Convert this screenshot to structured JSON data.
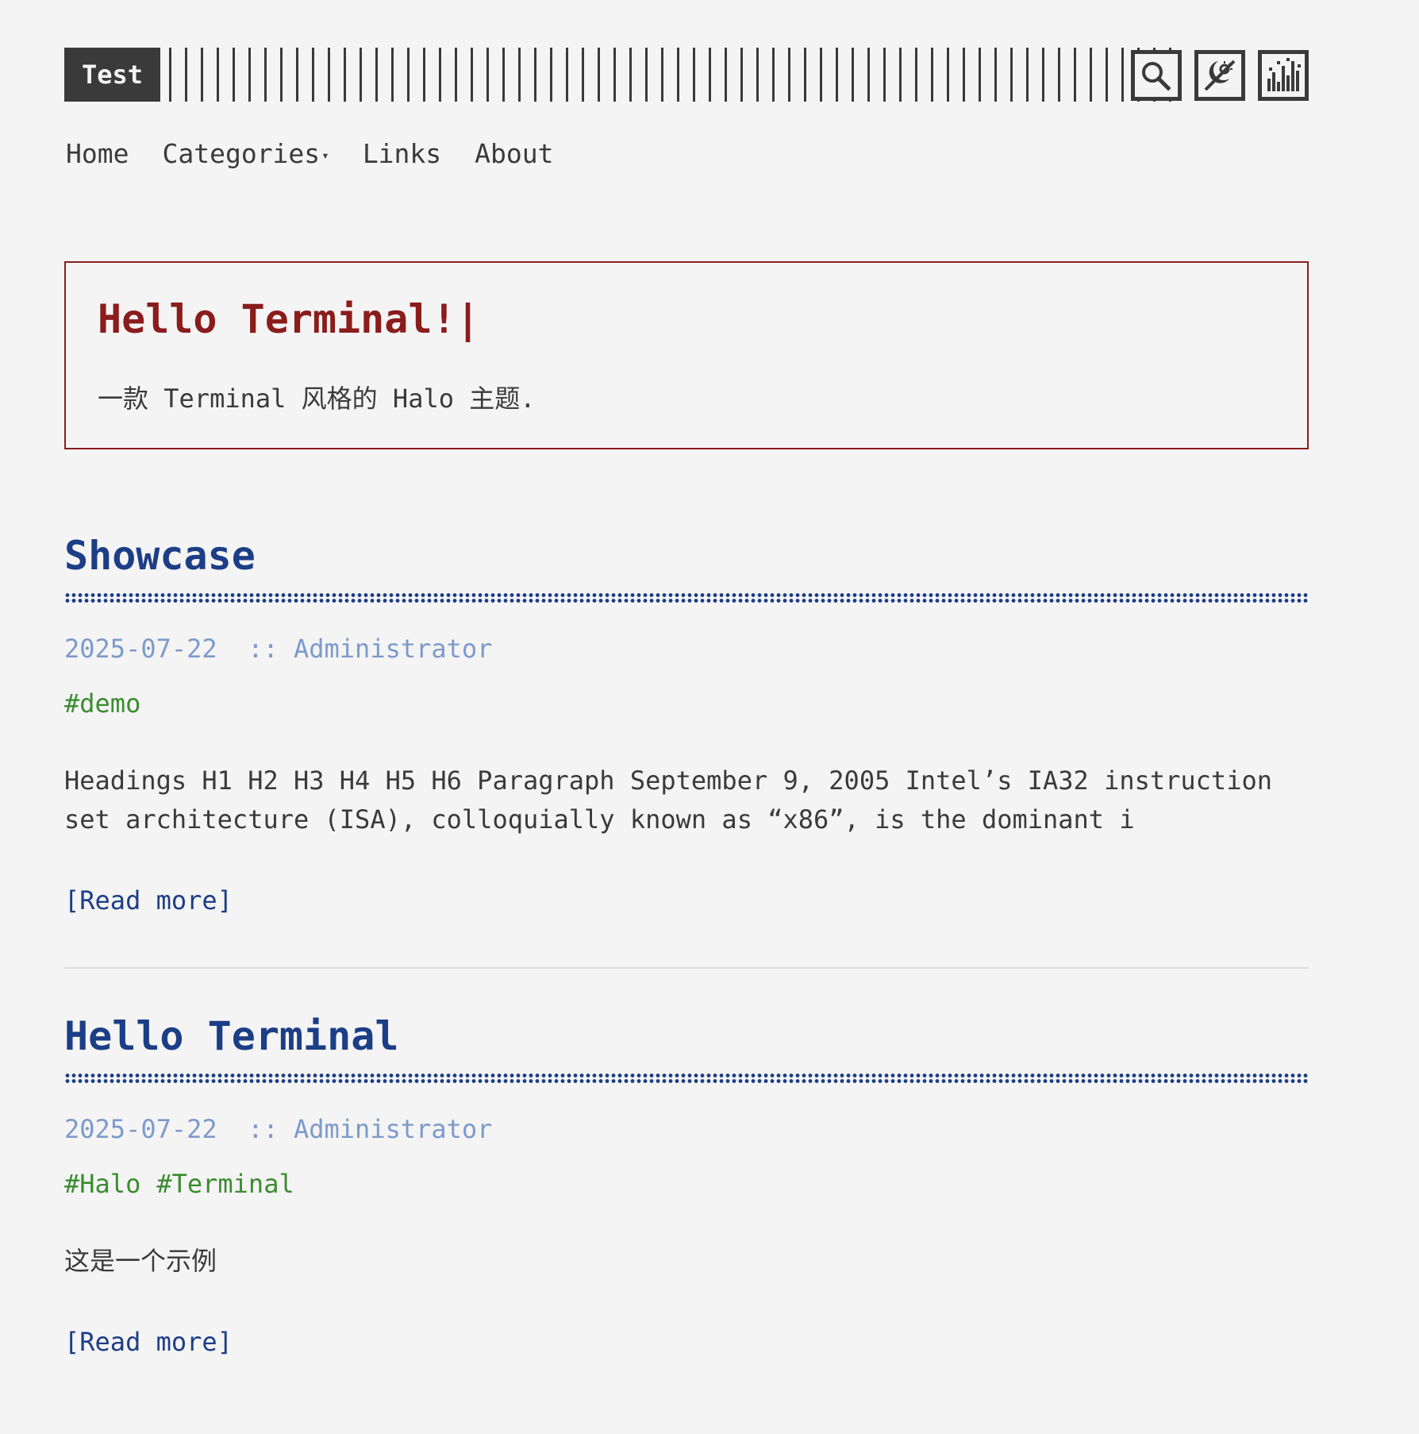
{
  "header": {
    "logo_text": "Test",
    "search_icon": "search-icon",
    "theme_icon": "theme-toggle-icon",
    "style_icon": "style-switch-icon"
  },
  "nav": {
    "items": [
      "Home",
      "Categories",
      "Links",
      "About"
    ],
    "categories_caret": "▾"
  },
  "hero": {
    "title": "Hello Terminal!",
    "cursor": "|",
    "subtitle": "一款 Terminal 风格的 Halo 主题."
  },
  "posts": [
    {
      "title": "Showcase",
      "date": "2025-07-22",
      "author_sep": "::",
      "author": "Administrator",
      "tags": [
        "#demo"
      ],
      "excerpt": "Headings H1 H2 H3 H4 H5 H6 Paragraph September 9, 2005 Intel’s IA32 instruction set architecture (ISA), colloquially known as “x86”, is the dominant i",
      "read_more": "[Read more]"
    },
    {
      "title": "Hello Terminal",
      "date": "2025-07-22",
      "author_sep": "::",
      "author": "Administrator",
      "tags": [
        "#Halo",
        "#Terminal"
      ],
      "excerpt": "这是一个示例",
      "read_more": "[Read more]"
    }
  ],
  "colors": {
    "background": "#f4f4f4",
    "text": "#3a3a3a",
    "accent_red": "#8b1c1c",
    "accent_blue": "#1c3e86",
    "meta_blue": "#7c9acb",
    "tag_green": "#3a8c2f"
  }
}
